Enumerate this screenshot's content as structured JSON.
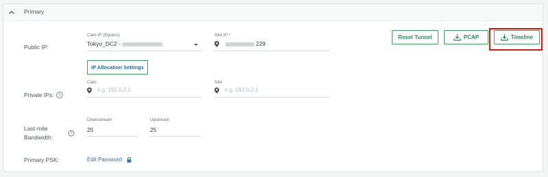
{
  "section": {
    "title": "Primary",
    "chevron_icon": "chevron-up-icon"
  },
  "public_ip": {
    "label": "Public IP:",
    "cato_ip_label": "Cato IP (Egress)",
    "cato_ip_value_prefix": "Tokyo_DC2 -",
    "site_ip_label": "Site IP",
    "site_ip_required_mark": "*",
    "site_ip_value_suffix": "229",
    "ip_allocation_button": "IP Allocation Settings"
  },
  "private_ips": {
    "label": "Private IPs:",
    "cato_label": "Cato",
    "cato_placeholder": "e.g. 192.0.2.1",
    "site_label": "Site",
    "site_placeholder": "e.g. 192.0.2.1"
  },
  "bandwidth": {
    "label_line1": "Last-mile",
    "label_line2": "Bandwidth:",
    "downstream_label": "Downstream",
    "downstream_value": "25",
    "upstream_label": "Upstream",
    "upstream_value": "25"
  },
  "psk": {
    "label": "Primary PSK:",
    "edit_link": "Edit Password"
  },
  "actions": {
    "reset_tunnel": "Reset Tunnel",
    "pcap": "PCAP",
    "timeline": "Timeline"
  },
  "colors": {
    "accent_green": "#2c8a55",
    "link_blue": "#2a70a8",
    "highlight_red": "#e11414"
  }
}
